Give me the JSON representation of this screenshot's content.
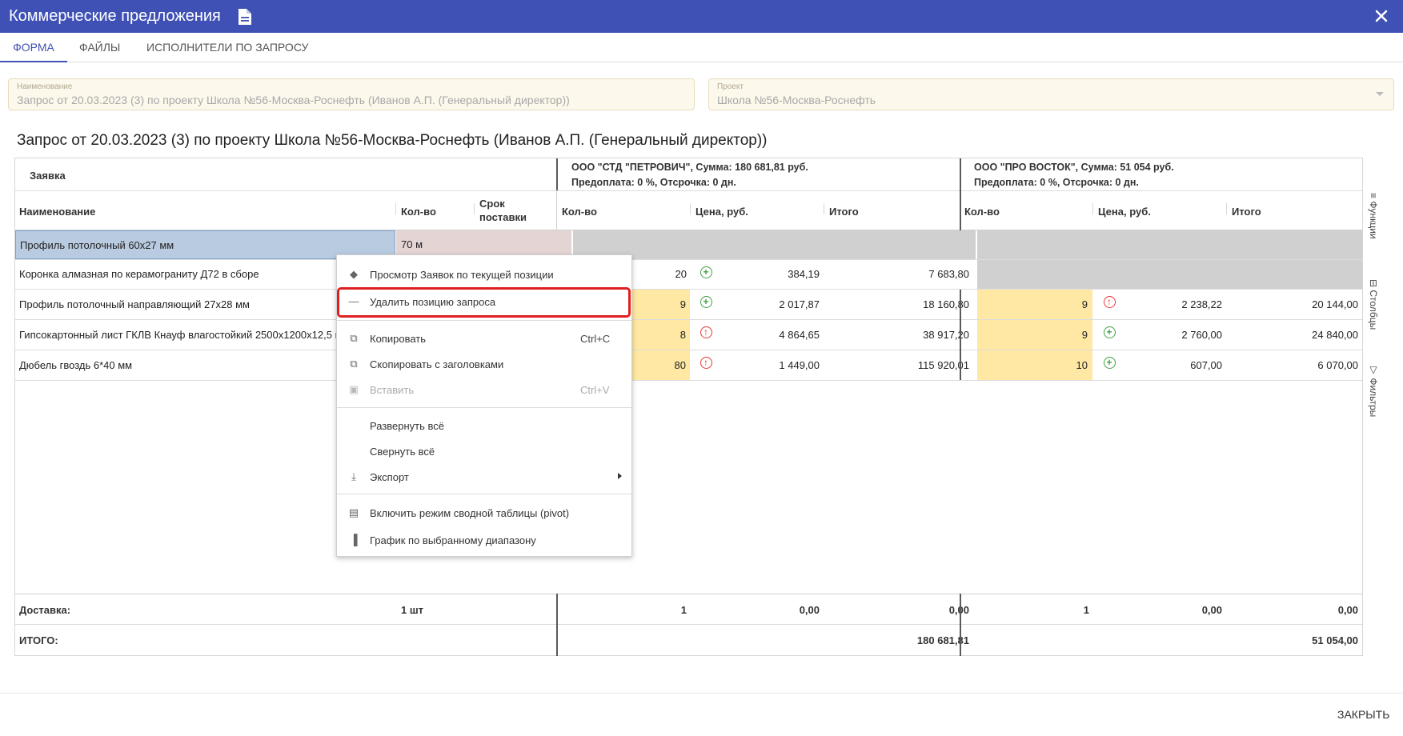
{
  "window": {
    "title": "Коммерческие предложения"
  },
  "tabs": [
    {
      "label": "ФОРМА",
      "active": true
    },
    {
      "label": "ФАЙЛЫ",
      "active": false
    },
    {
      "label": "ИСПОЛНИТЕЛИ ПО ЗАПРОСУ",
      "active": false
    }
  ],
  "fields": {
    "name": {
      "label": "Наименование",
      "value": "Запрос от 20.03.2023 (3)  по проекту Школа №56-Москва-Роснефть  (Иванов А.П. (Генеральный директор))"
    },
    "project": {
      "label": "Проект",
      "value": "Школа №56-Москва-Роснефть"
    }
  },
  "request_title": "Запрос от 20.03.2023 (3) по проекту Школа №56-Москва-Роснефть (Иванов А.П. (Генеральный директор))",
  "grid": {
    "group_request": "Заявка",
    "supplier1": {
      "line1": "ООО \"СТД \"ПЕТРОВИЧ\", Сумма: 180 681,81 руб.",
      "line2": "Предоплата: 0 %, Отсрочка: 0 дн."
    },
    "supplier2": {
      "line1": "ООО \"ПРО ВОСТОК\", Сумма: 51 054 руб.",
      "line2": "Предоплата: 0 %, Отсрочка: 0 дн."
    },
    "columns": {
      "name": "Наименование",
      "qty": "Кол-во",
      "term1": "Срок",
      "term2": "поставки",
      "s_qty": "Кол-во",
      "s_price": "Цена, руб.",
      "s_total": "Итого"
    },
    "rows": [
      {
        "name": "Профиль потолочный 60x27 мм",
        "qty": "70 м"
      },
      {
        "name": "Коронка алмазная по керамограниту Д72 в сборе",
        "s1_qty": "20",
        "s1_price": "384,19",
        "s1_total": "7 683,80"
      },
      {
        "name": "Профиль потолочный направляющий 27x28 мм",
        "s1_qty": "9",
        "s1_price": "2 017,87",
        "s1_total": "18 160,80",
        "s2_qty": "9",
        "s2_price": "2 238,22",
        "s2_total": "20 144,00"
      },
      {
        "name": "Гипсокартонный лист ГКЛВ Кнауф влагостойкий 2500x1200x12,5 мм",
        "s1_qty": "8",
        "s1_price": "4 864,65",
        "s1_total": "38 917,20",
        "s2_qty": "9",
        "s2_price": "2 760,00",
        "s2_total": "24 840,00"
      },
      {
        "name": "Дюбель гвоздь 6*40 мм",
        "s1_qty": "80",
        "s1_price": "1 449,00",
        "s1_total": "115 920,01",
        "s2_qty": "10",
        "s2_price": "607,00",
        "s2_total": "6 070,00"
      }
    ],
    "delivery": {
      "label": "Доставка:",
      "qty": "1 шт",
      "s1_qty": "1",
      "s1_price": "0,00",
      "s1_total": "0,00",
      "s2_qty": "1",
      "s2_price": "0,00",
      "s2_total": "0,00"
    },
    "total": {
      "label": "ИТОГО:",
      "s1_total": "180 681,81",
      "s2_total": "51 054,00"
    }
  },
  "side_panel": [
    "Функции",
    "Столбцы",
    "Фильтры"
  ],
  "context_menu": {
    "view_requests": "Просмотр Заявок по текущей позиции",
    "delete_position": "Удалить позицию запроса",
    "copy": "Копировать",
    "copy_shortcut": "Ctrl+C",
    "copy_headers": "Скопировать с заголовками",
    "paste": "Вставить",
    "paste_shortcut": "Ctrl+V",
    "expand_all": "Развернуть всё",
    "collapse_all": "Свернуть всё",
    "export": "Экспорт",
    "pivot": "Включить режим сводной таблицы (pivot)",
    "chart": "График по выбранному диапазону"
  },
  "footer": {
    "close_label": "ЗАКРЫТЬ"
  },
  "colors": {
    "header": "#3f51b5",
    "yellow": "#ffe8a3",
    "red": "#e53935",
    "green": "#43a047"
  }
}
